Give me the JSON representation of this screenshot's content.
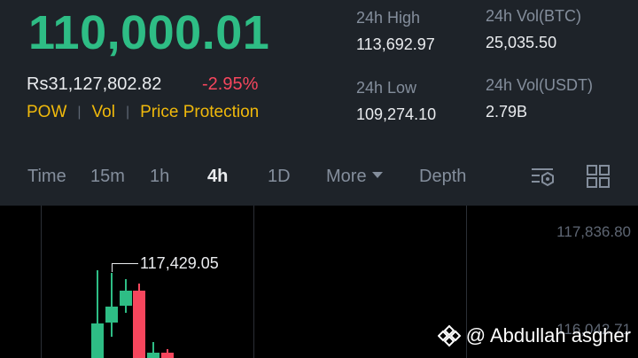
{
  "ticker": {
    "price": "110,000.01",
    "fiat_price": "Rs31,127,802.82",
    "change": "-2.95%",
    "tags": [
      "POW",
      "Vol",
      "Price Protection"
    ]
  },
  "stats": {
    "high_label": "24h High",
    "high_value": "113,692.97",
    "low_label": "24h Low",
    "low_value": "109,274.10",
    "vol_btc_label": "24h Vol(BTC)",
    "vol_btc_value": "25,035.50",
    "vol_usdt_label": "24h Vol(USDT)",
    "vol_usdt_value": "2.79B"
  },
  "tabs": {
    "time": "Time",
    "m15": "15m",
    "h1": "1h",
    "h4": "4h",
    "d1": "1D",
    "more": "More",
    "depth": "Depth",
    "active": "4h"
  },
  "icons": {
    "indicator": "chart-settings-icon",
    "layout": "grid-layout-icon"
  },
  "chart": {
    "axis_top": "117,836.80",
    "axis_partial": "116,042.71",
    "high_marker": "117,429.05",
    "up_color": "#2ebd85",
    "down_color": "#f6465d"
  },
  "watermark": {
    "text": "@ Abdullah asgher"
  }
}
